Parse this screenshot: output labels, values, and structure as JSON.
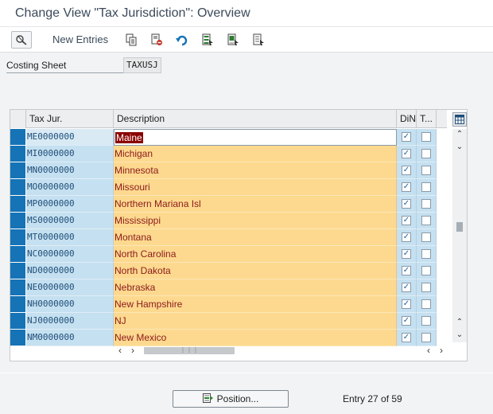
{
  "window": {
    "title": "Change View \"Tax Jurisdiction\": Overview"
  },
  "toolbar": {
    "new_entries_label": "New Entries",
    "icons": [
      "display-change-icon",
      "copy-icon",
      "delete-icon",
      "undo-icon",
      "select-all-icon",
      "select-block-icon",
      "deselect-all-icon"
    ]
  },
  "header_field": {
    "label": "Costing Sheet",
    "value": "TAXUSJ"
  },
  "table": {
    "columns": [
      "Tax Jur.",
      "Description",
      "DiN",
      "T..."
    ],
    "rows": [
      {
        "jur": "ME0000000",
        "desc": "Maine",
        "din": true,
        "t": false
      },
      {
        "jur": "MI0000000",
        "desc": "Michigan",
        "din": true,
        "t": false
      },
      {
        "jur": "MN0000000",
        "desc": "Minnesota",
        "din": true,
        "t": false
      },
      {
        "jur": "MO0000000",
        "desc": "Missouri",
        "din": true,
        "t": false
      },
      {
        "jur": "MP0000000",
        "desc": "Northern Mariana Isl",
        "din": true,
        "t": false
      },
      {
        "jur": "MS0000000",
        "desc": "Mississippi",
        "din": true,
        "t": false
      },
      {
        "jur": "MT0000000",
        "desc": "Montana",
        "din": true,
        "t": false
      },
      {
        "jur": "NC0000000",
        "desc": "North Carolina",
        "din": true,
        "t": false
      },
      {
        "jur": "ND0000000",
        "desc": "North Dakota",
        "din": true,
        "t": false
      },
      {
        "jur": "NE0000000",
        "desc": "Nebraska",
        "din": true,
        "t": false
      },
      {
        "jur": "NH0000000",
        "desc": "New Hampshire",
        "din": true,
        "t": false
      },
      {
        "jur": "NJ0000000",
        "desc": "NJ",
        "din": true,
        "t": false
      },
      {
        "jur": "NM0000000",
        "desc": "New Mexico",
        "din": true,
        "t": false
      }
    ]
  },
  "footer": {
    "position_label": "Position...",
    "entry_text": "Entry 27 of 59"
  },
  "colors": {
    "key_column": "#c5e0f0",
    "desc_column": "#fdd98f",
    "selector": "#1673b6",
    "desc_text": "#8b1a1a"
  }
}
